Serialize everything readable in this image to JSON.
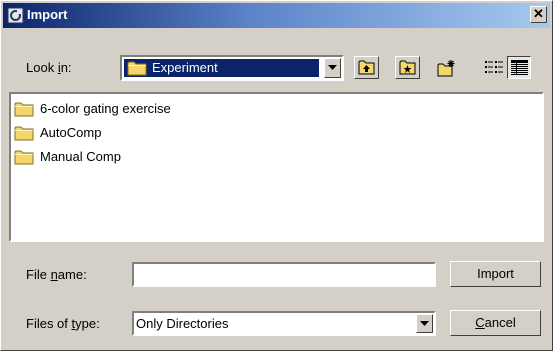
{
  "window": {
    "title": "Import",
    "close_glyph": "✕"
  },
  "look_in": {
    "label_pre": "Look ",
    "label_ul": "i",
    "label_post": "n:",
    "value": "Experiment",
    "icon": "folder-icon"
  },
  "toolbar": [
    "up-one-level-icon",
    "home-icon",
    "new-folder-icon",
    "list-view-icon",
    "details-view-icon"
  ],
  "files": [
    {
      "name": "6-color gating exercise",
      "icon": "folder-icon"
    },
    {
      "name": "AutoComp",
      "icon": "folder-icon"
    },
    {
      "name": "Manual Comp",
      "icon": "folder-icon"
    }
  ],
  "file_name": {
    "label_pre": "File ",
    "label_ul": "n",
    "label_post": "ame:",
    "value": ""
  },
  "file_type": {
    "label_pre": "Files of ",
    "label_ul": "t",
    "label_post": "ype:",
    "value": "Only Directories"
  },
  "buttons": {
    "import": "Import",
    "cancel_ul": "C",
    "cancel_rest": "ancel"
  },
  "colors": {
    "title_gradient_start": "#0a246a",
    "title_gradient_end": "#a6caf0",
    "selection": "#0a246a",
    "face": "#d4d0c8",
    "folder": "#f5d66b"
  }
}
